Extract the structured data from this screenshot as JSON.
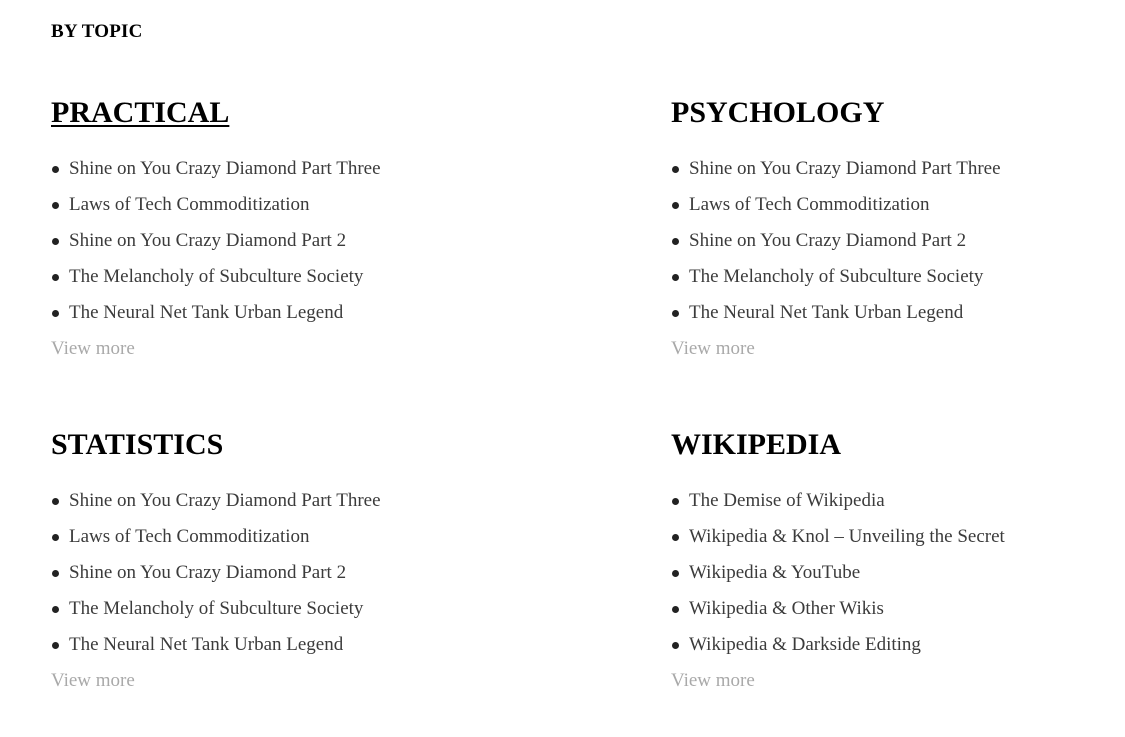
{
  "heading": "BY TOPIC",
  "view_more_label": "View more",
  "topics": [
    {
      "title": "PRACTICAL",
      "items": [
        "Shine on You Crazy Diamond Part Three",
        "Laws of Tech Commoditization",
        "Shine on You Crazy Diamond Part 2",
        "The Melancholy of Subculture Society",
        "The Neural Net Tank Urban Legend"
      ]
    },
    {
      "title": "PSYCHOLOGY",
      "items": [
        "Shine on You Crazy Diamond Part Three",
        "Laws of Tech Commoditization",
        "Shine on You Crazy Diamond Part 2",
        "The Melancholy of Subculture Society",
        "The Neural Net Tank Urban Legend"
      ]
    },
    {
      "title": "STATISTICS",
      "items": [
        "Shine on You Crazy Diamond Part Three",
        "Laws of Tech Commoditization",
        "Shine on You Crazy Diamond Part 2",
        "The Melancholy of Subculture Society",
        "The Neural Net Tank Urban Legend"
      ]
    },
    {
      "title": "WIKIPEDIA",
      "items": [
        "The Demise of Wikipedia",
        "Wikipedia & Knol – Unveiling the Secret",
        "Wikipedia & YouTube",
        "Wikipedia & Other Wikis",
        "Wikipedia & Darkside Editing"
      ]
    }
  ]
}
